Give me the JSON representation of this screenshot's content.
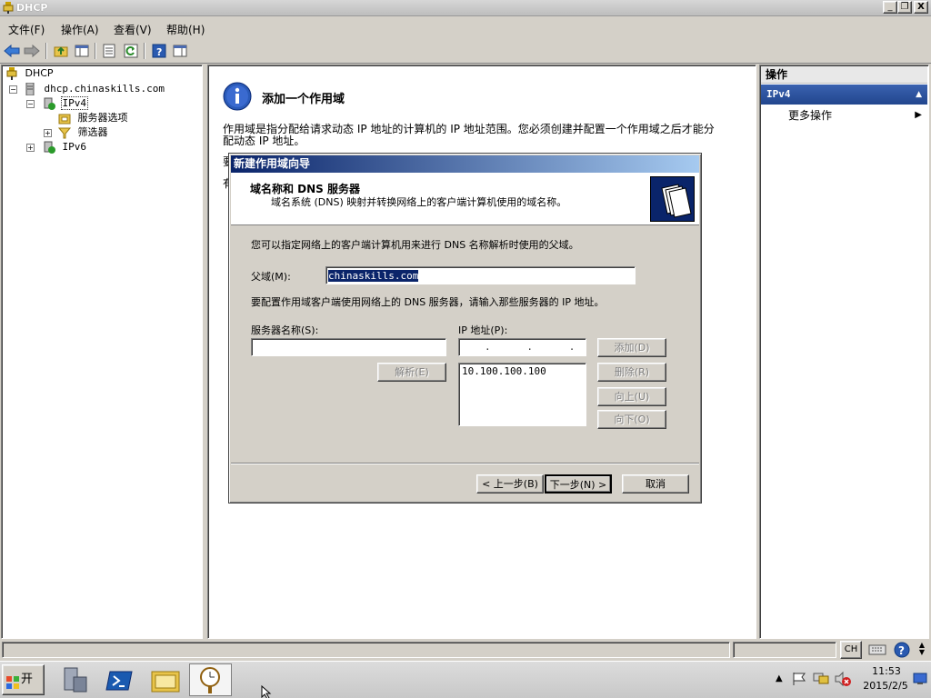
{
  "window": {
    "title": "DHCP",
    "minimize": "_",
    "restore": "❐",
    "close": "X"
  },
  "menu": [
    {
      "label": "文件(F)"
    },
    {
      "label": "操作(A)"
    },
    {
      "label": "查看(V)"
    },
    {
      "label": "帮助(H)"
    }
  ],
  "tree": {
    "root": "DHCP",
    "server": "dhcp.chinaskills.com",
    "ipv4": "IPv4",
    "server_options": "服务器选项",
    "filters": "筛选器",
    "ipv6": "IPv6"
  },
  "center": {
    "heading": "添加一个作用域",
    "description_line1": "作用域是指分配给请求动态 IP 地址的计算机的 IP 地址范围。您必须创建并配置一个作用域之后才能分",
    "description_line2": "配动态 IP 地址。",
    "partial1": "要",
    "partial2": "有"
  },
  "actions": {
    "header": "操作",
    "section": "IPv4",
    "more": "更多操作"
  },
  "dialog": {
    "title": "新建作用域向导",
    "step_title": "域名称和 DNS 服务器",
    "step_desc": "域名系统 (DNS) 映射并转换网络上的客户端计算机使用的域名称。",
    "intro": "您可以指定网络上的客户端计算机用来进行 DNS 名称解析时使用的父域。",
    "parent_domain_label": "父域(M):",
    "parent_domain_value": "chinaskills.com",
    "dns_instruction": "要配置作用域客户端使用网络上的 DNS 服务器，请输入那些服务器的 IP 地址。",
    "server_name_label": "服务器名称(S):",
    "server_name_value": "",
    "ip_label": "IP 地址(P):",
    "ip_placeholder": ".      .      .",
    "resolve_button": "解析(E)",
    "add_button": "添加(D)",
    "remove_button": "删除(R)",
    "up_button": "向上(U)",
    "down_button": "向下(O)",
    "ip_list": [
      "10.100.100.100"
    ],
    "back_button": "< 上一步(B)",
    "next_button": "下一步(N) >",
    "cancel_button": "取消"
  },
  "taskbar": {
    "start": "开始",
    "lang": "CH",
    "time": "11:53",
    "date": "2015/2/5"
  },
  "colors": {
    "accent": "#0a246a",
    "action_header": "#2c4e96"
  }
}
